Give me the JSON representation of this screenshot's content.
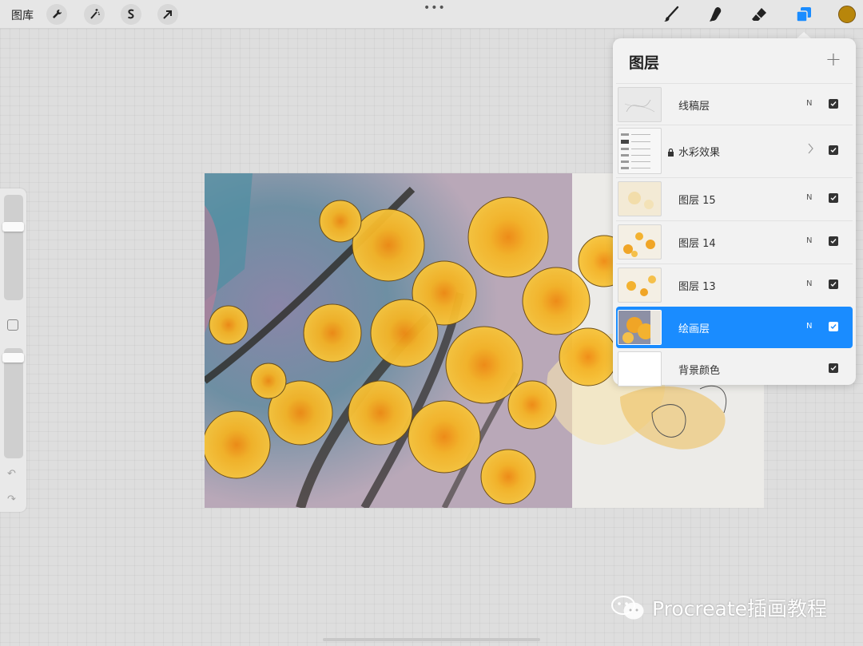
{
  "toolbar": {
    "gallery_label": "图库",
    "left_tools": [
      {
        "icon": "wrench-icon"
      },
      {
        "icon": "magic-wand-icon"
      },
      {
        "icon": "selection-s-icon"
      },
      {
        "icon": "transform-arrow-icon"
      }
    ],
    "more_label": "•••",
    "right_tools": [
      {
        "icon": "brush-icon"
      },
      {
        "icon": "smudge-icon"
      },
      {
        "icon": "eraser-icon"
      },
      {
        "icon": "layers-icon",
        "active": true
      }
    ],
    "current_color": "#b8860b"
  },
  "sidebar": {
    "brush_size_level": 0.28,
    "opacity_level": 0.05,
    "undo_label": "↶",
    "redo_label": "↷"
  },
  "layers_panel": {
    "title": "图层",
    "add_label": "+",
    "layers": [
      {
        "name": "线稿层",
        "blend": "N",
        "visible": true,
        "selected": false
      },
      {
        "name": "水彩效果",
        "blend": "",
        "visible": true,
        "selected": false,
        "locked": true,
        "group": true
      },
      {
        "name": "图层 15",
        "blend": "N",
        "visible": true,
        "selected": false
      },
      {
        "name": "图层 14",
        "blend": "N",
        "visible": true,
        "selected": false
      },
      {
        "name": "图层 13",
        "blend": "N",
        "visible": true,
        "selected": false
      },
      {
        "name": "绘画层",
        "blend": "N",
        "visible": true,
        "selected": true
      },
      {
        "name": "背景颜色",
        "blend": "",
        "visible": true,
        "selected": false
      }
    ]
  },
  "watermark": {
    "text": "Procreate插画教程"
  },
  "colors": {
    "accent": "#1a8cff",
    "panel_bg": "#f2f2f2"
  }
}
